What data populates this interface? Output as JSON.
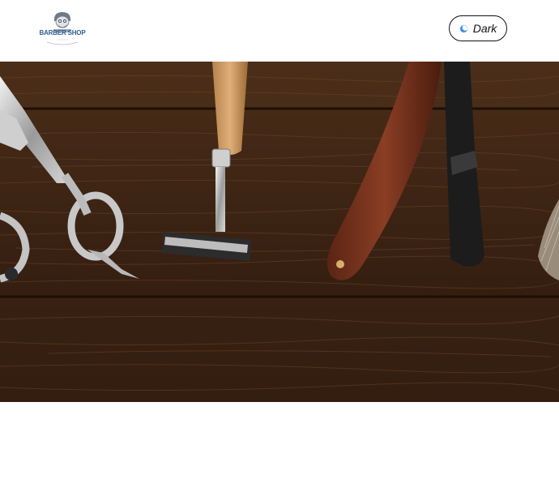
{
  "header": {
    "logo": {
      "text": "BARBER SHOP",
      "icon": "barber-logo-icon"
    },
    "theme_toggle": {
      "label": "Dark",
      "icon": "moon-icon"
    }
  },
  "hero": {
    "image": "barber-tools-photo",
    "items": [
      "scissors-icon",
      "safety-razor-icon",
      "straight-razor-icon",
      "shaving-brush-icon"
    ]
  },
  "colors": {
    "background": "#ffffff",
    "wood": "#3e2515",
    "toggle_border": "#111111",
    "moon_accent": "#3b8bea",
    "logo_blue": "#2f5f8f"
  }
}
